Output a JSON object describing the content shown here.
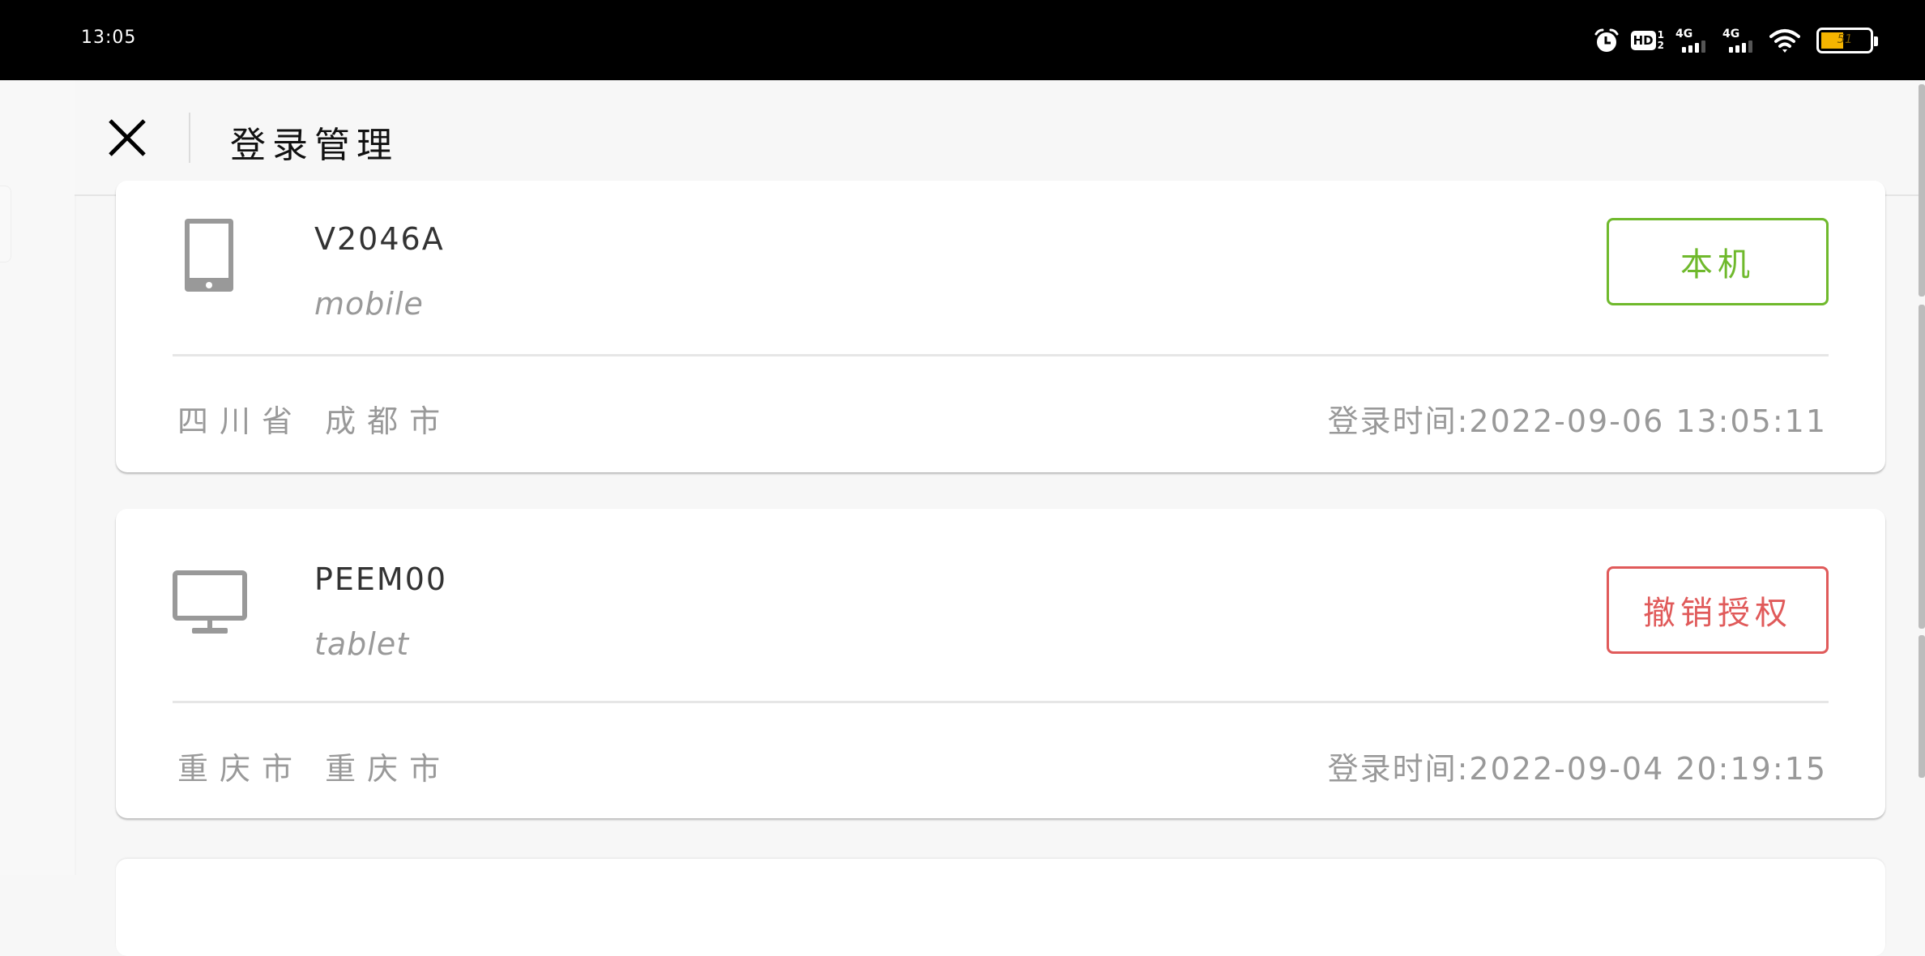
{
  "status_bar": {
    "time": "13:05",
    "icons": [
      "alarm-icon",
      "hd-voice-icon",
      "signal-4g-icon",
      "signal-4g-icon",
      "wifi-icon",
      "battery-icon"
    ],
    "hd_label": "HD",
    "sim_labels": [
      "1",
      "2"
    ],
    "network_labels": [
      "4G",
      "4G"
    ],
    "battery_percent": 51,
    "battery_text": "51",
    "battery_color": "#f5b400"
  },
  "header": {
    "title": "登录管理",
    "close_icon": "close-icon"
  },
  "devices": [
    {
      "name": "V2046A",
      "type": "mobile",
      "icon": "mobile-phone-icon",
      "button_label": "本机",
      "button_color": "#6fb92c",
      "location": "四川省 成都市",
      "login_time": "登录时间:2022-09-06 13:05:11"
    },
    {
      "name": "PEEM00",
      "type": "tablet",
      "icon": "monitor-icon",
      "button_label": "撤销授权",
      "button_color": "#e05a5a",
      "location": "重庆市 重庆市",
      "login_time": "登录时间:2022-09-04 20:19:15"
    }
  ]
}
